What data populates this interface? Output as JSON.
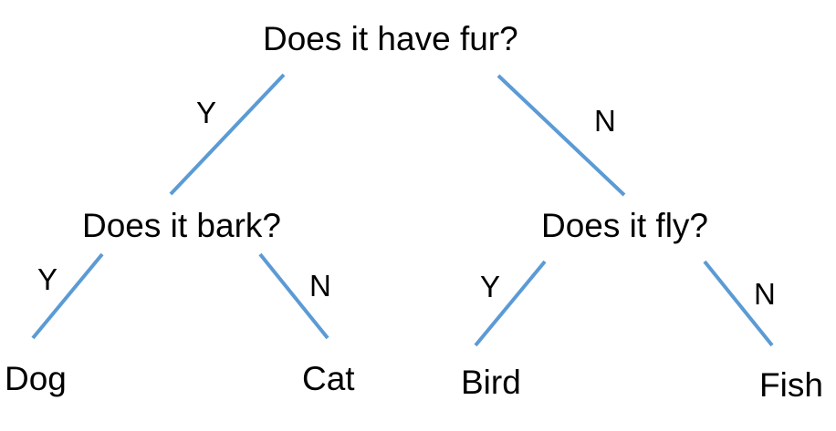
{
  "edge_color": "#5b9bd5",
  "nodes": {
    "root": {
      "text": "Does it have fur?"
    },
    "bark": {
      "text": "Does it bark?"
    },
    "fly": {
      "text": "Does it fly?"
    }
  },
  "leaves": {
    "dog": {
      "text": "Dog"
    },
    "cat": {
      "text": "Cat"
    },
    "bird": {
      "text": "Bird"
    },
    "fish": {
      "text": "Fish"
    }
  },
  "edges": {
    "root_yes": {
      "label": "Y"
    },
    "root_no": {
      "label": "N"
    },
    "bark_yes": {
      "label": "Y"
    },
    "bark_no": {
      "label": "N"
    },
    "fly_yes": {
      "label": "Y"
    },
    "fly_no": {
      "label": "N"
    }
  }
}
